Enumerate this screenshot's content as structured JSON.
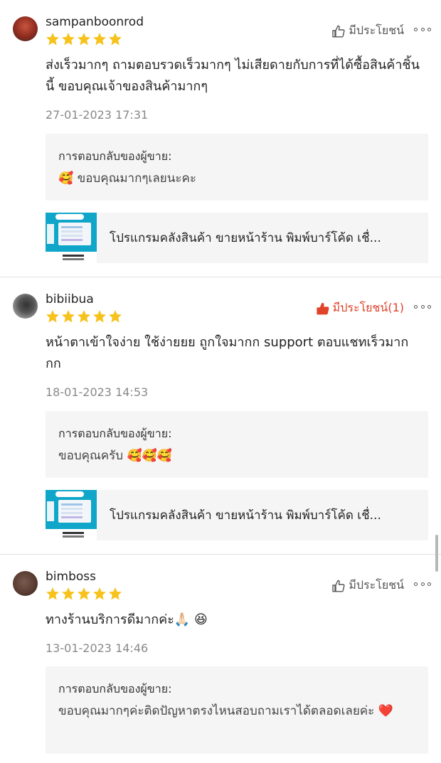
{
  "reviews": [
    {
      "username": "sampanboonrod",
      "rating": 5,
      "helpful_label": "มีประโยชน์",
      "helpful_active": false,
      "comment": "ส่งเร็วมากๆ ถามตอบรวดเร็วมากๆ ไม่เสียดายกับการที่ได้ซื้อสินค้าชิ้นนี้ ขอบคุณเจ้าของสินค้ามากๆ",
      "date": "27-01-2023 17:31",
      "reply_label": "การตอบกลับของผู้ขาย:",
      "reply_text": "🥰 ขอบคุณมากๆเลยนะคะ",
      "product_name": "โปรแกรมคลังสินค้า ขายหน้าร้าน พิมพ์บาร์โค้ด เชื่..."
    },
    {
      "username": "bibiibua",
      "rating": 5,
      "helpful_label": "มีประโยชน์(1)",
      "helpful_active": true,
      "comment": "หน้าตาเข้าใจง่าย ใช้ง่ายยย ถูกใจมากก support ตอบแชทเร็วมากกก",
      "date": "18-01-2023 14:53",
      "reply_label": "การตอบกลับของผู้ขาย:",
      "reply_text": "ขอบคุณครับ 🥰🥰🥰",
      "product_name": "โปรแกรมคลังสินค้า ขายหน้าร้าน พิมพ์บาร์โค้ด เชื่..."
    },
    {
      "username": "bimboss",
      "rating": 5,
      "helpful_label": "มีประโยชน์",
      "helpful_active": false,
      "comment": "ทางร้านบริการดีมากค่ะ🙏🏻 😆",
      "date": "13-01-2023 14:46",
      "reply_label": "การตอบกลับของผู้ขาย:",
      "reply_text": "ขอบคุณมากๆค่ะติดปัญหาตรงไหนสอบถามเราได้ตลอดเลยค่ะ ❤️"
    }
  ],
  "colors": {
    "star": "#f6c21b",
    "helpful_active": "#e0422a",
    "muted": "#888888",
    "reply_bg": "#f5f5f5"
  }
}
